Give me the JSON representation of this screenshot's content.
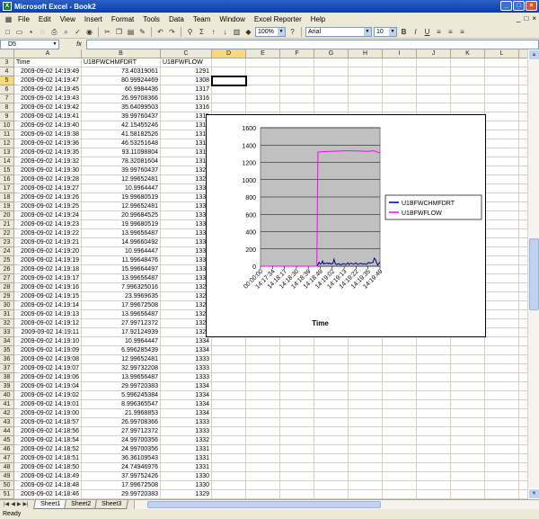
{
  "window": {
    "title": "Microsoft Excel - Book2"
  },
  "menu": [
    "File",
    "Edit",
    "View",
    "Insert",
    "Format",
    "Tools",
    "Data",
    "Team",
    "Window",
    "Excel Reporter",
    "Help"
  ],
  "toolbar": {
    "zoom": "100%",
    "font": "Arial",
    "font_size": "10",
    "bold": "B",
    "italic": "I",
    "underline": "U"
  },
  "formula_bar": {
    "name_box": "D5",
    "fx": "fx",
    "content": ""
  },
  "columns": [
    "A",
    "B",
    "C",
    "D",
    "E",
    "F",
    "G",
    "H",
    "I",
    "J",
    "K",
    "L",
    "M"
  ],
  "selected_cell": {
    "col": "D",
    "row": "5"
  },
  "rows": [
    {
      "n": "3",
      "a": "Time",
      "b": "U1BFWCHMFDRT",
      "c": "U1BFWFLOW"
    },
    {
      "n": "4",
      "a": "2009-09-02 14:19:49",
      "b": "73.40319061",
      "c": "1291"
    },
    {
      "n": "5",
      "a": "2009-09-02 14:19:47",
      "b": "80.99924469",
      "c": "1308"
    },
    {
      "n": "6",
      "a": "2009-09-02 14:19:45",
      "b": "60.9984436",
      "c": "1317"
    },
    {
      "n": "7",
      "a": "2009-09-02 14:19:43",
      "b": "26.99708366",
      "c": "1316"
    },
    {
      "n": "8",
      "a": "2009-09-02 14:19:42",
      "b": "35.64099503",
      "c": "1316"
    },
    {
      "n": "9",
      "a": "2009-09-02 14:19:41",
      "b": "39.99760437",
      "c": "1315"
    },
    {
      "n": "10",
      "a": "2009-09-02 14:19:40",
      "b": "42.15455246",
      "c": "1315"
    },
    {
      "n": "11",
      "a": "2009-09-02 14:19:38",
      "b": "41.58182526",
      "c": "1314"
    },
    {
      "n": "12",
      "a": "2009-09-02 14:19:36",
      "b": "46.53251648",
      "c": "1314"
    },
    {
      "n": "13",
      "a": "2009-09-02 14:19:35",
      "b": "93.11098804",
      "c": "1313"
    },
    {
      "n": "14",
      "a": "2009-09-02 14:19:32",
      "b": "78.32081604",
      "c": "1314"
    },
    {
      "n": "15",
      "a": "2009-09-02 14:19:30",
      "b": "39.99760437",
      "c": "1322"
    },
    {
      "n": "16",
      "a": "2009-09-02 14:19:28",
      "b": "12.99652481",
      "c": "1328"
    },
    {
      "n": "17",
      "a": "2009-09-02 14:19:27",
      "b": "10.9964447",
      "c": "1331"
    },
    {
      "n": "18",
      "a": "2009-09-02 14:19:26",
      "b": "19.99680519",
      "c": "1331"
    },
    {
      "n": "19",
      "a": "2009-09-02 14:19:25",
      "b": "12.99652481",
      "c": "1332"
    },
    {
      "n": "20",
      "a": "2009-09-02 14:19:24",
      "b": "20.99684525",
      "c": "1333"
    },
    {
      "n": "21",
      "a": "2009-09-02 14:19:23",
      "b": "19.99680519",
      "c": "1333"
    },
    {
      "n": "22",
      "a": "2009-09-02 14:19:22",
      "b": "13.99656487",
      "c": "1332"
    },
    {
      "n": "23",
      "a": "2009-09-02 14:19:21",
      "b": "14.99660492",
      "c": "1331"
    },
    {
      "n": "24",
      "a": "2009-09-02 14:19:20",
      "b": "10.9964447",
      "c": "1331"
    },
    {
      "n": "25",
      "a": "2009-09-02 14:19:19",
      "b": "11.99648476",
      "c": "1330"
    },
    {
      "n": "26",
      "a": "2009-09-02 14:19:18",
      "b": "15.99664497",
      "c": "1330"
    },
    {
      "n": "27",
      "a": "2009-09-02 14:19:17",
      "b": "13.99656487",
      "c": "1330"
    },
    {
      "n": "28",
      "a": "2009-09-02 14:19:16",
      "b": "7.996325016",
      "c": "1329"
    },
    {
      "n": "29",
      "a": "2009-09-02 14:19:15",
      "b": "23.9969635",
      "c": "1329"
    },
    {
      "n": "30",
      "a": "2009-09-02 14:19:14",
      "b": "17.99672508",
      "c": "1328"
    },
    {
      "n": "31",
      "a": "2009-09-02 14:19:13",
      "b": "13.99656487",
      "c": "1328"
    },
    {
      "n": "32",
      "a": "2009-09-02 14:19:12",
      "b": "27.99712372",
      "c": "1329"
    },
    {
      "n": "33",
      "a": "2009-09-02 14:19:11",
      "b": "17.92124939",
      "c": "1329"
    },
    {
      "n": "34",
      "a": "2009-09-02 14:19:10",
      "b": "10.9964447",
      "c": "1334"
    },
    {
      "n": "35",
      "a": "2009-09-02 14:19:09",
      "b": "6.996285439",
      "c": "1334"
    },
    {
      "n": "36",
      "a": "2009-09-02 14:19:08",
      "b": "12.99652481",
      "c": "1333"
    },
    {
      "n": "37",
      "a": "2009-09-02 14:19:07",
      "b": "32.99732208",
      "c": "1333"
    },
    {
      "n": "38",
      "a": "2009-09-02 14:19:06",
      "b": "13.99656487",
      "c": "1333"
    },
    {
      "n": "39",
      "a": "2009-09-02 14:19:04",
      "b": "29.99720383",
      "c": "1334"
    },
    {
      "n": "40",
      "a": "2009-09-02 14:19:02",
      "b": "5.996245384",
      "c": "1334"
    },
    {
      "n": "41",
      "a": "2009-09-02 14:19:01",
      "b": "8.996365547",
      "c": "1334"
    },
    {
      "n": "42",
      "a": "2009-09-02 14:19:00",
      "b": "21.9968853",
      "c": "1334"
    },
    {
      "n": "43",
      "a": "2009-09-02 14:18:57",
      "b": "26.99708366",
      "c": "1333"
    },
    {
      "n": "44",
      "a": "2009-09-02 14:18:56",
      "b": "27.99712372",
      "c": "1333"
    },
    {
      "n": "45",
      "a": "2009-09-02 14:18:54",
      "b": "24.99700356",
      "c": "1332"
    },
    {
      "n": "46",
      "a": "2009-09-02 14:18:52",
      "b": "24.99700356",
      "c": "1331"
    },
    {
      "n": "47",
      "a": "2009-09-02 14:18:51",
      "b": "36.36109543",
      "c": "1331"
    },
    {
      "n": "48",
      "a": "2009-09-02 14:18:50",
      "b": "24.74946976",
      "c": "1331"
    },
    {
      "n": "49",
      "a": "2009-09-02 14:18:49",
      "b": "37.99752426",
      "c": "1330"
    },
    {
      "n": "50",
      "a": "2009-09-02 14:18:48",
      "b": "17.99672508",
      "c": "1330"
    },
    {
      "n": "51",
      "a": "2009-09-02 14:18:46",
      "b": "29.99720383",
      "c": "1329"
    },
    {
      "n": "52",
      "a": "2009-09-02 14:18:45",
      "b": "10.9964447",
      "c": "1329"
    }
  ],
  "sheets": [
    "Sheet1",
    "Sheet2",
    "Sheet3"
  ],
  "active_sheet": "Sheet1",
  "status": "Ready",
  "chart_data": {
    "type": "line",
    "xlabel": "Time",
    "ylabel": "",
    "ylim": [
      0,
      1600
    ],
    "yticks": [
      "0",
      "200",
      "400",
      "600",
      "800",
      "1000",
      "1200",
      "1400",
      "1600"
    ],
    "xticks": [
      "00:00:00",
      "14:17:34",
      "14:18:17",
      "14:18:30",
      "14:18:39",
      "14:18:49",
      "14:19:02",
      "14:19:13",
      "14:19:22",
      "14:19:35",
      "14:19:49"
    ],
    "plot_background": "#c0c0c0",
    "legend_position": "right",
    "series": [
      {
        "name": "U1BFWCHMFDRT",
        "color": "#000080",
        "values": [
          0,
          0,
          0,
          0,
          0,
          0,
          0,
          0,
          0,
          0,
          0,
          0,
          0,
          0,
          0,
          0,
          0,
          0,
          0,
          0,
          0,
          0,
          0,
          0,
          0,
          0,
          0,
          0,
          0,
          0,
          0,
          0,
          0,
          0,
          0,
          0,
          0,
          0,
          0,
          0,
          0,
          0,
          0,
          0,
          0,
          0,
          0,
          0,
          0,
          0,
          20,
          45,
          25,
          30,
          60,
          25,
          35,
          30,
          40,
          28,
          38,
          25,
          32,
          30,
          80,
          35,
          20,
          25,
          30,
          22,
          18,
          25,
          30,
          28,
          20,
          25,
          40,
          22,
          30,
          35,
          28,
          25,
          30,
          40,
          26,
          22,
          28,
          35,
          30,
          25,
          30,
          28,
          22,
          30,
          45,
          35,
          40,
          42,
          46,
          93,
          78,
          40,
          13,
          30,
          50
        ]
      },
      {
        "name": "U1BFWFLOW",
        "color": "#ff00ff",
        "values": [
          0,
          0,
          0,
          0,
          0,
          0,
          0,
          0,
          0,
          0,
          0,
          0,
          0,
          0,
          0,
          0,
          0,
          0,
          0,
          0,
          0,
          0,
          0,
          0,
          0,
          0,
          0,
          0,
          0,
          0,
          0,
          0,
          0,
          0,
          0,
          0,
          0,
          0,
          0,
          0,
          0,
          0,
          0,
          0,
          0,
          0,
          0,
          0,
          0,
          0,
          1318,
          1320,
          1322,
          1322,
          1323,
          1324,
          1325,
          1325,
          1326,
          1326,
          1327,
          1327,
          1328,
          1328,
          1329,
          1329,
          1330,
          1330,
          1331,
          1331,
          1332,
          1332,
          1333,
          1333,
          1333,
          1334,
          1334,
          1334,
          1334,
          1334,
          1333,
          1333,
          1333,
          1332,
          1332,
          1331,
          1331,
          1330,
          1330,
          1330,
          1329,
          1329,
          1328,
          1328,
          1329,
          1329,
          1331,
          1331,
          1332,
          1333,
          1328,
          1322,
          1316,
          1314,
          1308
        ]
      }
    ]
  }
}
